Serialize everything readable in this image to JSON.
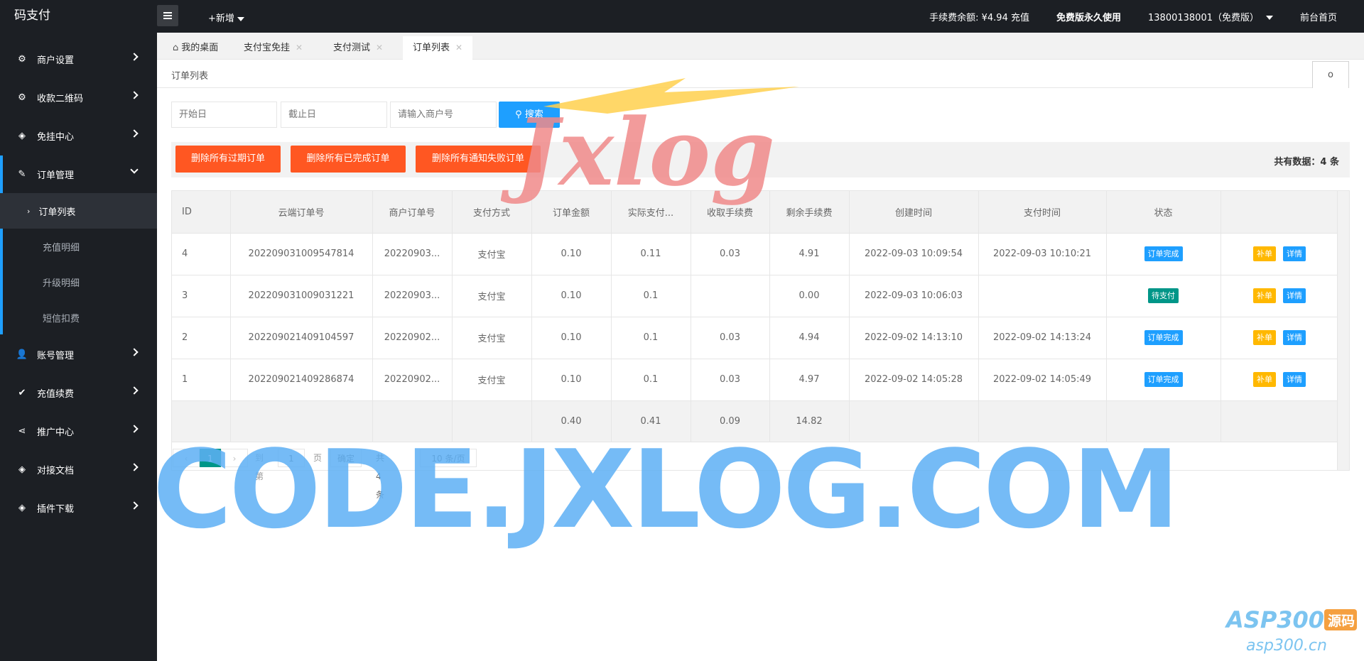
{
  "app": {
    "logo": "码支付"
  },
  "topbar": {
    "new_label": "+新增",
    "balance": "手续费余额: ¥4.94 充值",
    "edition": "免费版永久使用",
    "user": "13800138001（免费版）",
    "home": "前台首页"
  },
  "sidebar": {
    "items": [
      {
        "label": "商户设置",
        "icon": "gear-icon"
      },
      {
        "label": "收款二维码",
        "icon": "gear-icon"
      },
      {
        "label": "免挂中心",
        "icon": "cube-icon"
      },
      {
        "label": "订单管理",
        "icon": "edit-icon"
      },
      {
        "label": "账号管理",
        "icon": "user-icon"
      },
      {
        "label": "充值续费",
        "icon": "check-icon"
      },
      {
        "label": "推广中心",
        "icon": "share-icon"
      },
      {
        "label": "对接文档",
        "icon": "cube-icon"
      },
      {
        "label": "插件下载",
        "icon": "cube-icon"
      }
    ],
    "sub_items": [
      {
        "label": "订单列表"
      },
      {
        "label": "充值明细"
      },
      {
        "label": "升级明细"
      },
      {
        "label": "短信扣费"
      }
    ]
  },
  "tabs": [
    {
      "label": "我的桌面"
    },
    {
      "label": "支付宝免挂"
    },
    {
      "label": "支付测试"
    },
    {
      "label": "订单列表"
    }
  ],
  "breadcrumb": "订单列表",
  "refresh_label": "ο",
  "search": {
    "start_placeholder": "开始日",
    "end_placeholder": "截止日",
    "merchant_placeholder": "请输入商户号",
    "button": "搜索"
  },
  "actions": {
    "del_expired": "删除所有过期订单",
    "del_completed": "删除所有已完成订单",
    "del_failed": "删除所有通知失败订单",
    "total": "共有数据：4 条"
  },
  "table": {
    "headers": [
      "ID",
      "云端订单号",
      "商户订单号",
      "支付方式",
      "订单金额",
      "实际支付...",
      "收取手续费",
      "剩余手续费",
      "创建时间",
      "支付时间",
      "状态",
      ""
    ],
    "rows": [
      {
        "id": "4",
        "cloud_no": "202209031009547814",
        "merchant_no": "20220903...",
        "pay": "支付宝",
        "amount": "0.10",
        "actual": "0.11",
        "fee": "0.03",
        "remain": "4.91",
        "created": "2022-09-03 10:09:54",
        "paid": "2022-09-03 10:10:21",
        "status": "订单完成",
        "status_color": "#1e9fff"
      },
      {
        "id": "3",
        "cloud_no": "202209031009031221",
        "merchant_no": "20220903...",
        "pay": "支付宝",
        "amount": "0.10",
        "actual": "0.1",
        "fee": "",
        "remain": "0.00",
        "created": "2022-09-03 10:06:03",
        "paid": "",
        "status": "待支付",
        "status_color": "#009688"
      },
      {
        "id": "2",
        "cloud_no": "202209021409104597",
        "merchant_no": "20220902...",
        "pay": "支付宝",
        "amount": "0.10",
        "actual": "0.1",
        "fee": "0.03",
        "remain": "4.94",
        "created": "2022-09-02 14:13:10",
        "paid": "2022-09-02 14:13:24",
        "status": "订单完成",
        "status_color": "#1e9fff"
      },
      {
        "id": "1",
        "cloud_no": "202209021409286874",
        "merchant_no": "20220902...",
        "pay": "支付宝",
        "amount": "0.10",
        "actual": "0.1",
        "fee": "0.03",
        "remain": "4.97",
        "created": "2022-09-02 14:05:28",
        "paid": "2022-09-02 14:05:49",
        "status": "订单完成",
        "status_color": "#1e9fff"
      }
    ],
    "op_reorder": "补单",
    "op_detail": "详情",
    "sum": {
      "amount": "0.40",
      "actual": "0.41",
      "fee": "0.09",
      "remain": "14.82"
    }
  },
  "pager": {
    "current": "1",
    "goto": "到第",
    "page_value": "1",
    "page_unit": "页",
    "confirm": "确定",
    "total": "共 4 条",
    "page_size": "10 条/页"
  },
  "watermarks": {
    "big": "CODE.JXLOG.COM",
    "logo": "Jxlog",
    "asp": "ASP300",
    "asp_badge": "源码",
    "asp_url": "asp300.cn"
  }
}
